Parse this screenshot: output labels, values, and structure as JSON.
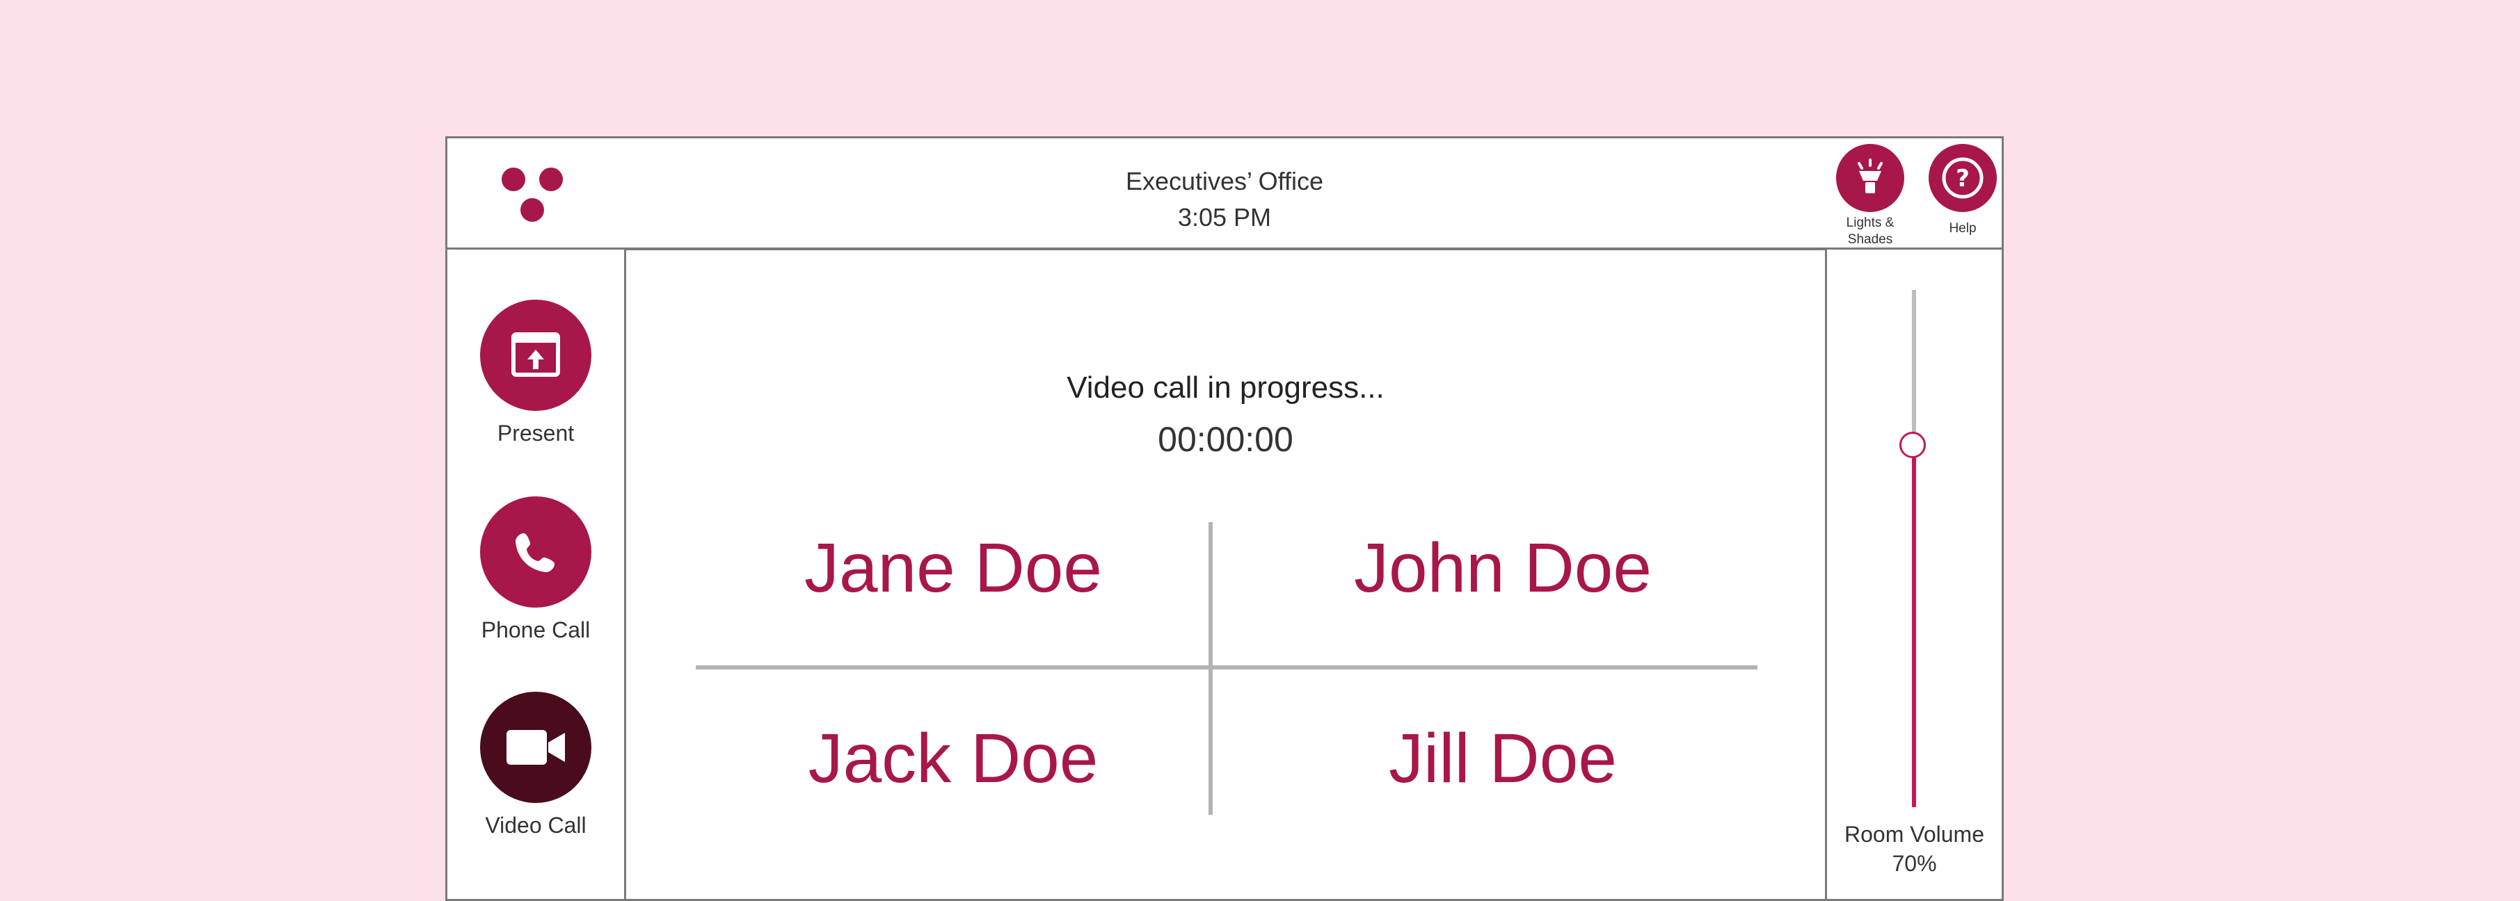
{
  "header": {
    "room_title": "Executives’ Office",
    "time": "3:05 PM",
    "lights_label_line1": "Lights &",
    "lights_label_line2": "Shades",
    "help_label": "Help"
  },
  "sidebar": {
    "items": [
      {
        "label": "Present",
        "icon": "present-icon"
      },
      {
        "label": "Phone Call",
        "icon": "phone-icon"
      },
      {
        "label": "Video Call",
        "icon": "video-camera-icon"
      }
    ]
  },
  "call": {
    "status": "Video call in progress...",
    "timer": "00:00:00",
    "participants": [
      "Jane Doe",
      "John Doe",
      "Jack Doe",
      "Jill Doe"
    ]
  },
  "volume": {
    "label": "Room Volume",
    "value_text": "70%",
    "level": 0.7
  },
  "colors": {
    "background": "#fde1ea",
    "accent": "#a8174a",
    "accent_dark": "#4a0b1d",
    "slider": "#c3195a"
  }
}
